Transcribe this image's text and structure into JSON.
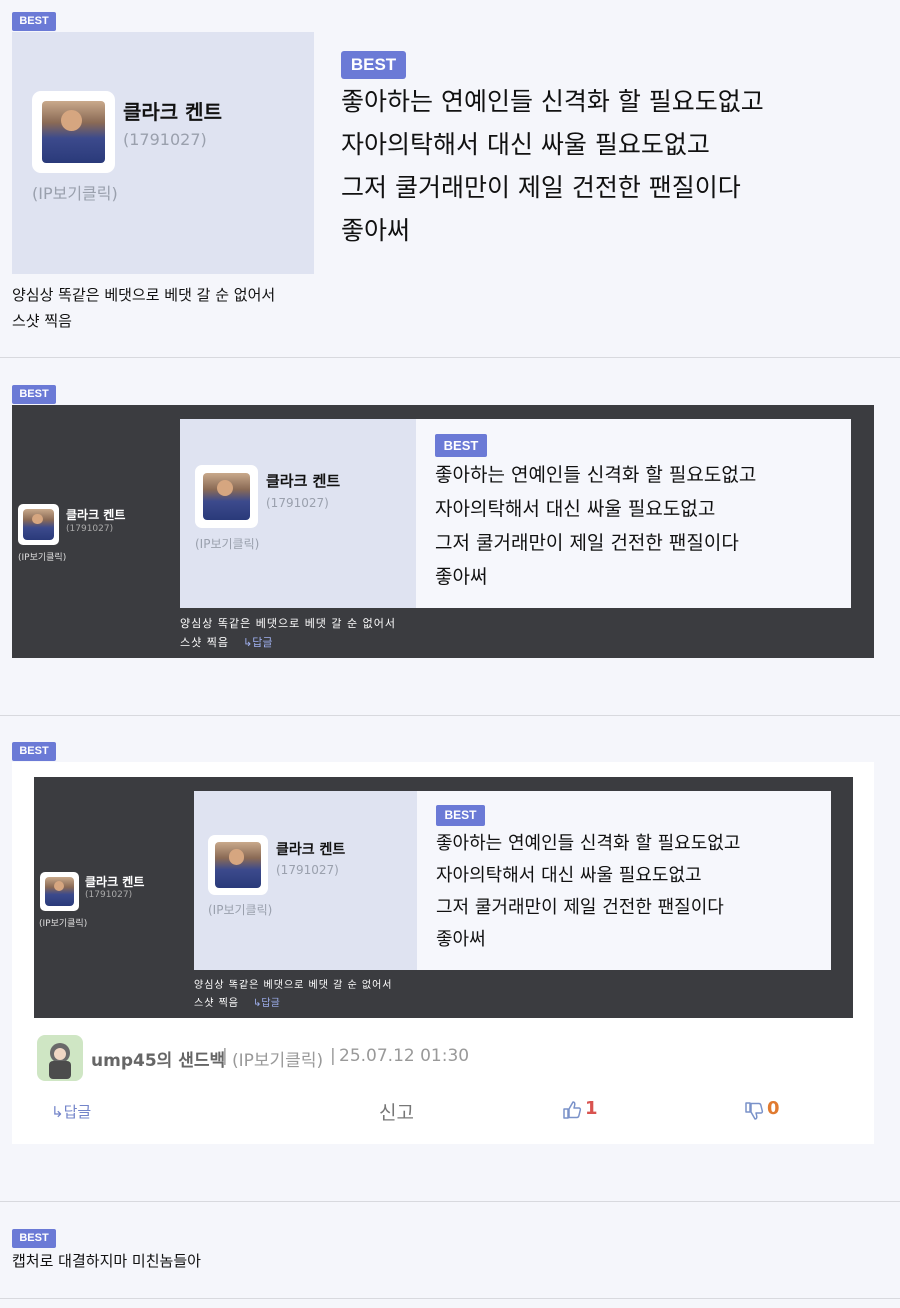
{
  "badge": "BEST",
  "profile": {
    "nickname": "클라크 켄트",
    "user_id": "(1791027)",
    "ip_label": "(IP보기클릭)"
  },
  "post_lines": [
    "좋아하는 연예인들 신격화 할 필요도없고",
    "자아의탁해서 대신 싸울 필요도없고",
    "그저 쿨거래만이 제일 건전한 팬질이다",
    "좋아써"
  ],
  "caption_lines": [
    "양심상 똑같은 베댓으로 베댓 갈 순 없어서",
    "스샷 찍음"
  ],
  "reply_label": "↳답글",
  "comment": {
    "author": "ump45의 샌드백",
    "ip_label": "(IP보기클릭)",
    "timestamp": "25.07.12 01:30",
    "reply_label": "↳답글",
    "report_label": "신고",
    "like_count": "1",
    "dislike_count": "0",
    "colors": {
      "like": "#d9534f",
      "dislike": "#e07a30",
      "accent": "#6b7ad6"
    }
  },
  "last_comment": "캡처로 대결하지마 미친놈들아",
  "icons": [
    "thumbs-up-icon",
    "thumbs-down-icon",
    "reply-arrow-icon"
  ]
}
